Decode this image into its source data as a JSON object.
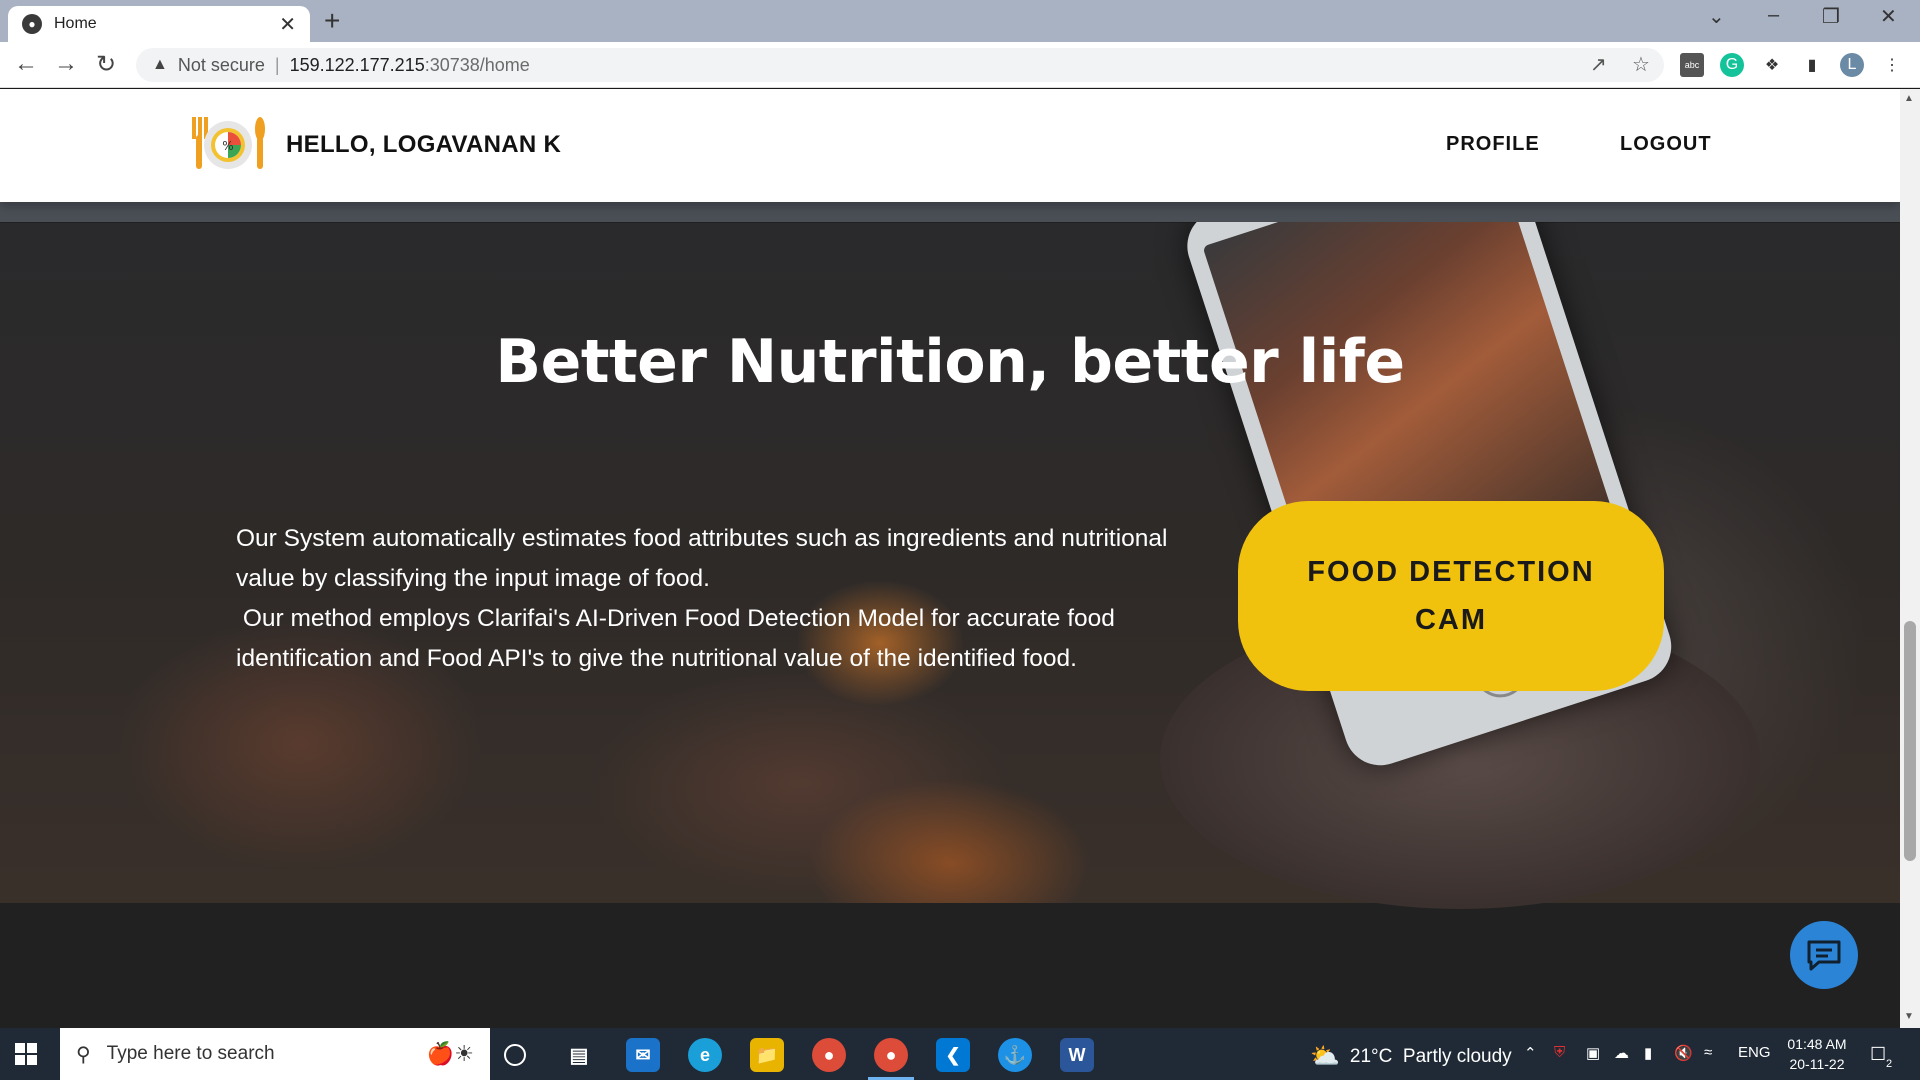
{
  "browser": {
    "tab_title": "Home",
    "address": {
      "security_label": "Not secure",
      "separator": "|",
      "host": "159.122.177.215",
      "path": ":30738/home"
    },
    "profile_initial": "L"
  },
  "site": {
    "greeting": "HELLO, LOGAVANAN K",
    "nav": {
      "profile": "PROFILE",
      "logout": "LOGOUT"
    },
    "hero": {
      "title": "Better Nutrition, better life",
      "paragraph1": "Our System automatically estimates food attributes such as ingredients and nutritional value by classifying the input image of food.",
      "paragraph2": " Our method employs Clarifai's AI-Driven Food Detection Model for accurate food identification and Food API's to give the nutritional value of the identified food.",
      "cta_label": "FOOD DETECTION CAM"
    },
    "colors": {
      "accent": "#f0c20e",
      "chat_button": "#2b84d6"
    }
  },
  "taskbar": {
    "search_placeholder": "Type here to search",
    "weather_temp": "21°C",
    "weather_desc": "Partly cloudy",
    "language": "ENG",
    "time": "01:48 AM",
    "date": "20-11-22",
    "notification_count": "2",
    "word_icon_letter": "W"
  }
}
